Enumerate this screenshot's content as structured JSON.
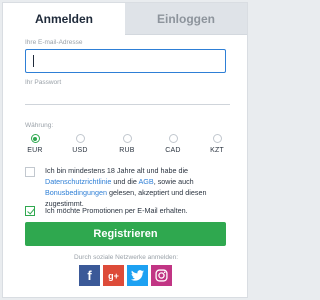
{
  "tabs": [
    {
      "label": "Anmelden",
      "active": true
    },
    {
      "label": "Einloggen",
      "active": false
    }
  ],
  "email": {
    "label": "Ihre E-mail-Adresse",
    "value": ""
  },
  "password": {
    "label": "Ihr Passwort",
    "value": ""
  },
  "currency": {
    "label": "Währung:",
    "options": [
      "EUR",
      "USD",
      "RUB",
      "CAD",
      "KZT"
    ],
    "selected": "EUR"
  },
  "terms": {
    "checked": false,
    "text1": "Ich bin mindestens 18 Jahre alt und habe die ",
    "link1": "Datenschutzrichtlinie",
    "text2": " und die ",
    "link2": "AGB",
    "text3": ", sowie auch ",
    "link3": "Bonusbedingungen",
    "text4": " gelesen, akzeptiert und diesen zugestimmt."
  },
  "promo": {
    "checked": true,
    "label": "Ich möchte Promotionen per E-Mail erhalten."
  },
  "submit_label": "Registrieren",
  "social": {
    "caption": "Durch soziale Netzwerke anmelden:",
    "networks": [
      {
        "name": "facebook",
        "glyph": "f",
        "color": "#3b5998"
      },
      {
        "name": "google-plus",
        "glyph": "g+",
        "color": "#dd4b39"
      },
      {
        "name": "twitter",
        "glyph": "",
        "color": "#1da1f2"
      },
      {
        "name": "instagram",
        "glyph": "",
        "color": "#c13584"
      }
    ]
  },
  "colors": {
    "accent": "#2fa84f",
    "link": "#2e7fd6",
    "focus": "#2e7fd6"
  }
}
